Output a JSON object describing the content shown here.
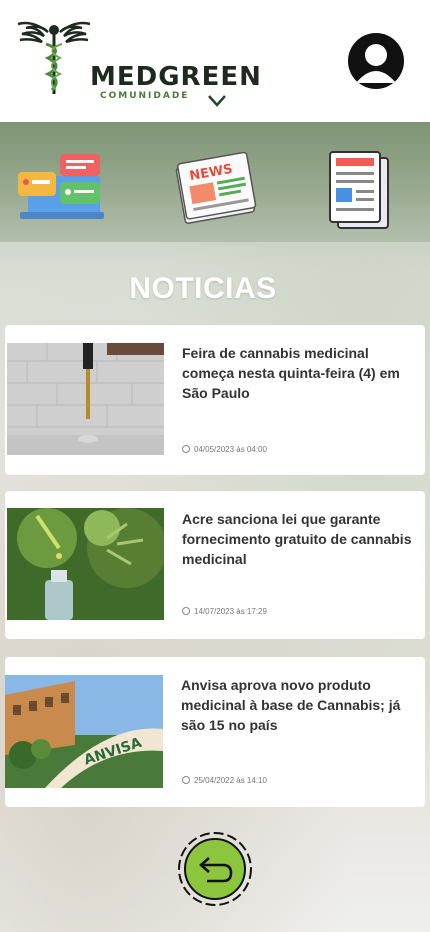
{
  "brand": {
    "name": "MEDGREEN",
    "tagline": "COMUNIDADE"
  },
  "header": {
    "avatar_icon": "user-avatar-icon",
    "menu_icon": "chevron-down-icon"
  },
  "nav_icons": [
    "chat-icon",
    "news-icon",
    "document-icon"
  ],
  "page": {
    "title": "NOTICIAS"
  },
  "news": [
    {
      "headline": "Feira de cannabis medicinal começa nesta quinta-feira (4) em São Paulo",
      "date": "04/05/2023 às 04:00"
    },
    {
      "headline": "Acre sanciona lei que garante fornecimento gratuito de cannabis medicinal",
      "date": "14/07/2023 às 17:29"
    },
    {
      "headline": "Anvisa aprova novo produto medicinal à base de Cannabis; já são 15 no país",
      "date": "25/04/2022 às 14:10"
    }
  ],
  "thumb_text": {
    "anvisa": "ANVISA"
  },
  "colors": {
    "accent": "#8cc63f",
    "brand_dark": "#1e2a1e",
    "brand_green": "#4b7a3a"
  },
  "back_button": {
    "icon": "return-arrow-icon"
  }
}
